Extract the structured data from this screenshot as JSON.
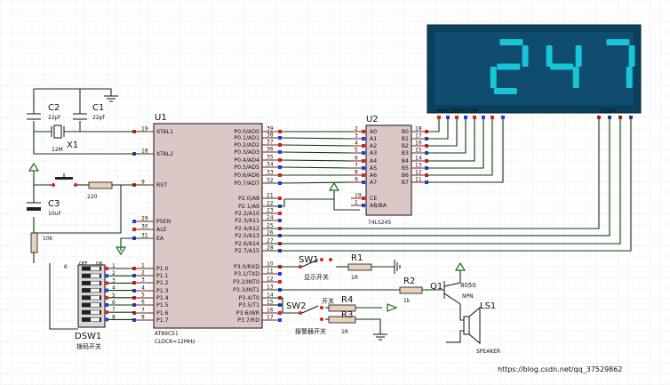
{
  "title": "",
  "display": {
    "digits": [
      "2",
      "4",
      "7"
    ],
    "segments_label": "ABCDEFG DP",
    "digit_select_label": "1234",
    "segment_color": "#18c4d8",
    "frame_color": "#0b3f5e"
  },
  "u1": {
    "ref": "U1",
    "part": "AT89C51",
    "clock": "CLOCK=12MHz",
    "left_pins": [
      {
        "num": "19",
        "name": "XTAL1"
      },
      {
        "num": "18",
        "name": "XTAL2"
      },
      {
        "num": "9",
        "name": "RST"
      },
      {
        "num": "29",
        "name": "PSEN"
      },
      {
        "num": "30",
        "name": "ALE"
      },
      {
        "num": "31",
        "name": "EA"
      },
      {
        "num": "1",
        "name": "P1.0"
      },
      {
        "num": "2",
        "name": "P1.1"
      },
      {
        "num": "3",
        "name": "P1.2"
      },
      {
        "num": "4",
        "name": "P1.3"
      },
      {
        "num": "5",
        "name": "P1.4"
      },
      {
        "num": "6",
        "name": "P1.5"
      },
      {
        "num": "7",
        "name": "P1.6"
      },
      {
        "num": "8",
        "name": "P1.7"
      }
    ],
    "right_pins": [
      {
        "num": "39",
        "name": "P0.0/AD0"
      },
      {
        "num": "38",
        "name": "P0.1/AD1"
      },
      {
        "num": "37",
        "name": "P0.2/AD2"
      },
      {
        "num": "36",
        "name": "P0.3/AD3"
      },
      {
        "num": "35",
        "name": "P0.4/AD4"
      },
      {
        "num": "34",
        "name": "P0.5/AD5"
      },
      {
        "num": "33",
        "name": "P0.6/AD6"
      },
      {
        "num": "32",
        "name": "P0.7/AD7"
      },
      {
        "num": "21",
        "name": "P2.0/A8"
      },
      {
        "num": "22",
        "name": "P2.1/A9"
      },
      {
        "num": "23",
        "name": "P2.2/A10"
      },
      {
        "num": "24",
        "name": "P2.3/A11"
      },
      {
        "num": "25",
        "name": "P2.4/A12"
      },
      {
        "num": "26",
        "name": "P2.5/A13"
      },
      {
        "num": "27",
        "name": "P2.6/A14"
      },
      {
        "num": "28",
        "name": "P2.7/A15"
      },
      {
        "num": "10",
        "name": "P3.0/RXD"
      },
      {
        "num": "11",
        "name": "P3.1/TXD"
      },
      {
        "num": "12",
        "name": "P3.2/INT0"
      },
      {
        "num": "13",
        "name": "P3.3/INT1"
      },
      {
        "num": "14",
        "name": "P3.4/T0"
      },
      {
        "num": "15",
        "name": "P3.5/T1"
      },
      {
        "num": "16",
        "name": "P3.6/WR"
      },
      {
        "num": "17",
        "name": "P3.7/RD"
      }
    ]
  },
  "u2": {
    "ref": "U2",
    "part": "74LS245",
    "left_pins": [
      {
        "num": "2",
        "name": "A0"
      },
      {
        "num": "3",
        "name": "A1"
      },
      {
        "num": "4",
        "name": "A2"
      },
      {
        "num": "5",
        "name": "A3"
      },
      {
        "num": "6",
        "name": "A4"
      },
      {
        "num": "7",
        "name": "A5"
      },
      {
        "num": "8",
        "name": "A6"
      },
      {
        "num": "9",
        "name": "A7"
      },
      {
        "num": "19",
        "name": "CE"
      },
      {
        "num": "1",
        "name": "AB/BA"
      }
    ],
    "right_pins": [
      {
        "num": "18",
        "name": "B0"
      },
      {
        "num": "17",
        "name": "B1"
      },
      {
        "num": "16",
        "name": "B2"
      },
      {
        "num": "15",
        "name": "B3"
      },
      {
        "num": "14",
        "name": "B4"
      },
      {
        "num": "13",
        "name": "B5"
      },
      {
        "num": "12",
        "name": "B6"
      },
      {
        "num": "11",
        "name": "B7"
      }
    ]
  },
  "parts": {
    "c2": {
      "ref": "C2",
      "value": "22pf"
    },
    "c1": {
      "ref": "C1",
      "value": "22pf"
    },
    "x1": {
      "ref": "X1",
      "value": "12M"
    },
    "c3": {
      "ref": "C3",
      "value": "10uF"
    },
    "r_rst": {
      "value": "220"
    },
    "r_pd": {
      "value": "10k"
    },
    "sw1": {
      "ref": "SW1",
      "label": "显示开关"
    },
    "sw2": {
      "ref": "SW2",
      "label": "报警器开关"
    },
    "r1": {
      "ref": "R1",
      "value": "1R"
    },
    "r2": {
      "ref": "R2",
      "value": "1k"
    },
    "r3": {
      "ref": "R3",
      "value": "1R"
    },
    "r4": {
      "ref": "R4",
      "value": "1R"
    },
    "switch_label": "开关",
    "q1": {
      "ref": "Q1",
      "part": "8050",
      "type": "NPN"
    },
    "ls1": {
      "ref": "LS1",
      "part": "SPEAKER"
    },
    "dsw1": {
      "ref": "DSW1",
      "label": "拨码开关",
      "off": "OFF",
      "on": "ON",
      "pin_left": "6"
    }
  },
  "watermark": "https://blog.csdn.net/qq_37529862"
}
